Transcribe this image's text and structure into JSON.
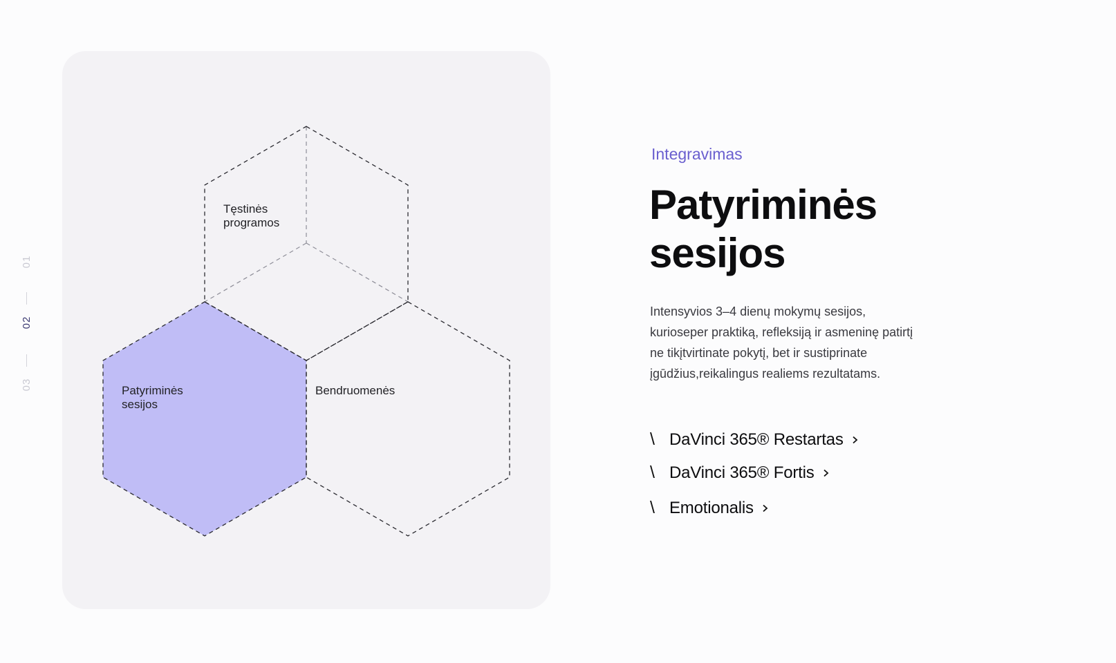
{
  "steps": [
    {
      "label": "01",
      "active": false
    },
    {
      "label": "02",
      "active": true
    },
    {
      "label": "03",
      "active": false
    }
  ],
  "diagram": {
    "hexes": [
      {
        "label_line1": "Tęstinės",
        "label_line2": "programos",
        "highlighted": false
      },
      {
        "label_line1": "Patyriminės",
        "label_line2": "sesijos",
        "highlighted": true
      },
      {
        "label_line1": "Bendruomenės",
        "label_line2": "",
        "highlighted": false
      }
    ],
    "highlight_color": "#c0bdf6"
  },
  "content": {
    "eyebrow": "Integravimas",
    "title_line1": "Patyriminės",
    "title_line2": "sesijos",
    "description_lines": [
      "Intensyvios 3–4 dienų mokymų sesijos,",
      "kurioseper praktiką, refleksiją ir asmeninę patirtį",
      "ne tikįtvirtinate pokytį, bet ir sustiprinate",
      "įgūdžius,reikalingus realiems rezultatams."
    ],
    "links": [
      {
        "slash": "\\",
        "label": "DaVinci 365® Restartas"
      },
      {
        "slash": "\\",
        "label": "DaVinci 365® Fortis"
      },
      {
        "slash": "\\",
        "label": "Emotionalis"
      }
    ]
  },
  "colors": {
    "accent": "#6a5fcf",
    "card_bg": "#f3f2f5",
    "page_bg": "#fcfcfd"
  }
}
